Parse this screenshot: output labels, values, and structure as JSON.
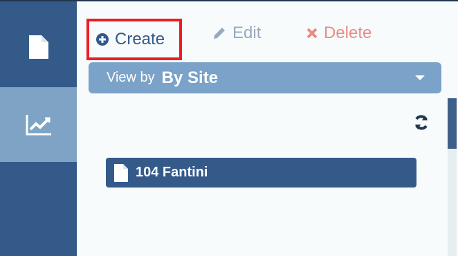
{
  "sidebar": {
    "items": [
      {
        "name": "documents",
        "icon": "document-icon"
      },
      {
        "name": "analytics",
        "icon": "chart-line-icon",
        "active": true
      }
    ]
  },
  "toolbar": {
    "create_label": "Create",
    "edit_label": "Edit",
    "delete_label": "Delete"
  },
  "view_by": {
    "label": "View by",
    "value": "By Site"
  },
  "list": {
    "items": [
      {
        "label": "104 Fantini",
        "icon": "document-icon"
      }
    ]
  },
  "colors": {
    "rail": "#345a8a",
    "rail_active": "#7ea3c4",
    "create_highlight": "#ee1c25",
    "delete": "#e88b86",
    "edit_disabled": "#97a9bd"
  }
}
